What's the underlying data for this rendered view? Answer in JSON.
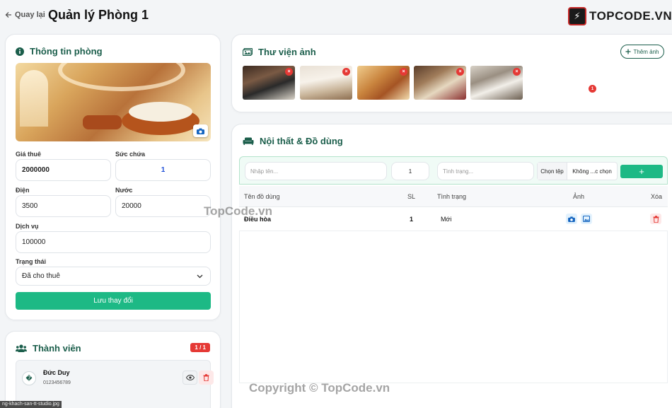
{
  "header": {
    "back_label": "Quay lại",
    "title": "Quản lý Phòng 1",
    "logo_text": "TOPCODE.VN"
  },
  "room": {
    "heading": "Thông tin phòng",
    "price_label": "Giá thuê",
    "price_value": "2000000",
    "capacity_label": "Sức chứa",
    "capacity_value": "1",
    "electric_label": "Điện",
    "electric_value": "3500",
    "water_label": "Nước",
    "water_value": "20000",
    "service_label": "Dịch vụ",
    "service_value": "100000",
    "status_label": "Trạng thái",
    "status_value": "Đã cho thuê",
    "save_label": "Lưu thay đổi"
  },
  "members": {
    "heading": "Thành viên",
    "count": "1 / 1",
    "items": [
      {
        "name": "Đức Duy",
        "phone": "0123456789"
      }
    ]
  },
  "gallery": {
    "heading": "Thư viện ảnh",
    "add_label": "Thêm ảnh"
  },
  "furniture": {
    "heading": "Nội thất & Đồ dùng",
    "name_placeholder": "Nhập tên...",
    "qty_value": "1",
    "condition_placeholder": "Tình trạng...",
    "choose_file": "Chọn tệp",
    "no_file": "Không ...c chọn",
    "add_symbol": "+",
    "columns": {
      "name": "Tên đồ dùng",
      "qty": "SL",
      "condition": "Tình trạng",
      "image": "Ảnh",
      "delete": "Xóa"
    },
    "rows": [
      {
        "name": "Điều hòa",
        "qty": "1",
        "condition": "Mới",
        "image_count": "1"
      }
    ]
  },
  "watermarks": {
    "center": "TopCode.vn",
    "bottom": "Copyright © TopCode.vn"
  },
  "filename": "ng-khach-san-tt-studio.jpg",
  "colors": {
    "accent": "#1db985",
    "heading": "#1b5e4b",
    "danger": "#e53935"
  }
}
